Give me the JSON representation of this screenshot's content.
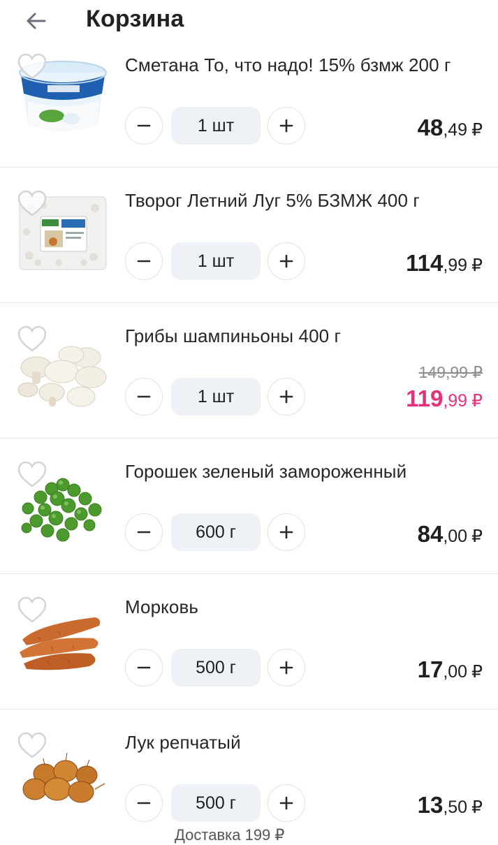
{
  "header": {
    "title": "Корзина",
    "back_icon": "arrow-left-icon"
  },
  "colors": {
    "sale": "#ea2f7a",
    "divider": "#e8e8ec",
    "qty_bg": "#eef1f5"
  },
  "items": [
    {
      "name": "Сметана То, что надо! 15% бзмж 200 г",
      "qty": "1 шт",
      "price_int": "48",
      "price_frac": ",49",
      "currency": "₽",
      "image": "sour-cream-cup"
    },
    {
      "name": "Творог Летний Луг 5% БЗМЖ 400 г",
      "qty": "1 шт",
      "price_int": "114",
      "price_frac": ",99",
      "currency": "₽",
      "image": "cottage-cheese-pack"
    },
    {
      "name": "Грибы шампиньоны 400 г",
      "qty": "1 шт",
      "old_price": "149,99 ₽",
      "price_int": "119",
      "price_frac": ",99",
      "currency": "₽",
      "sale": true,
      "image": "champignons"
    },
    {
      "name": "Горошек зеленый замороженный",
      "qty": "600 г",
      "price_int": "84",
      "price_frac": ",00",
      "currency": "₽",
      "image": "green-peas"
    },
    {
      "name": "Морковь",
      "qty": "500 г",
      "price_int": "17",
      "price_frac": ",00",
      "currency": "₽",
      "image": "carrots"
    },
    {
      "name": "Лук репчатый",
      "qty": "500 г",
      "price_int": "13",
      "price_frac": ",50",
      "currency": "₽",
      "image": "onions"
    }
  ],
  "footer_partial": "Доставка 199 ₽"
}
